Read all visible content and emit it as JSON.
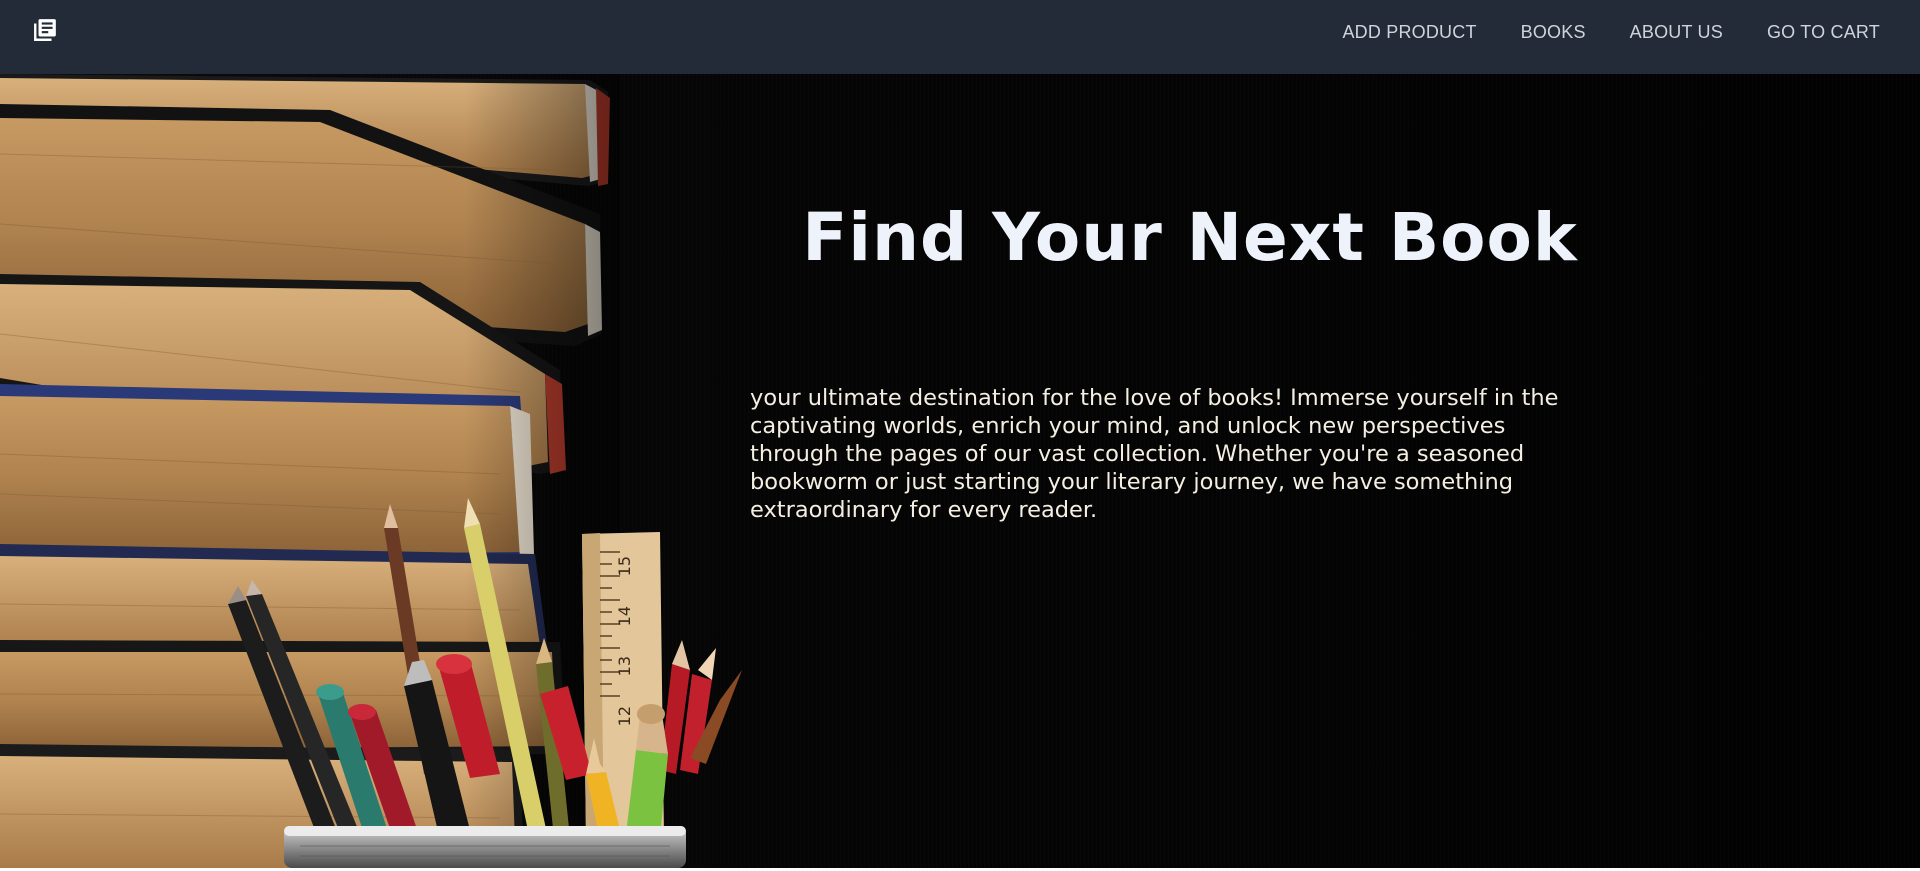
{
  "nav": {
    "logo_icon": "newspaper-list-icon",
    "links": [
      "ADD PRODUCT",
      "BOOKS",
      "ABOUT US",
      "GO TO CART"
    ]
  },
  "hero": {
    "title": "Find Your Next Book",
    "description": "your ultimate destination for the love of books! Immerse yourself in the captivating worlds, enrich your mind, and unlock new perspectives through the pages of our vast collection. Whether you're a seasoned bookworm or just starting your literary journey, we have something extraordinary for every reader.",
    "image_subject": "stack-of-books-and-pencil-cup",
    "ruler_ticks": [
      "15",
      "14",
      "13",
      "12"
    ]
  },
  "colors": {
    "navbar": "#222b37",
    "nav_text": "#cfd4dc",
    "hero_bg": "#050505",
    "title": "#eef2fb",
    "body_text": "#f4efe2"
  }
}
